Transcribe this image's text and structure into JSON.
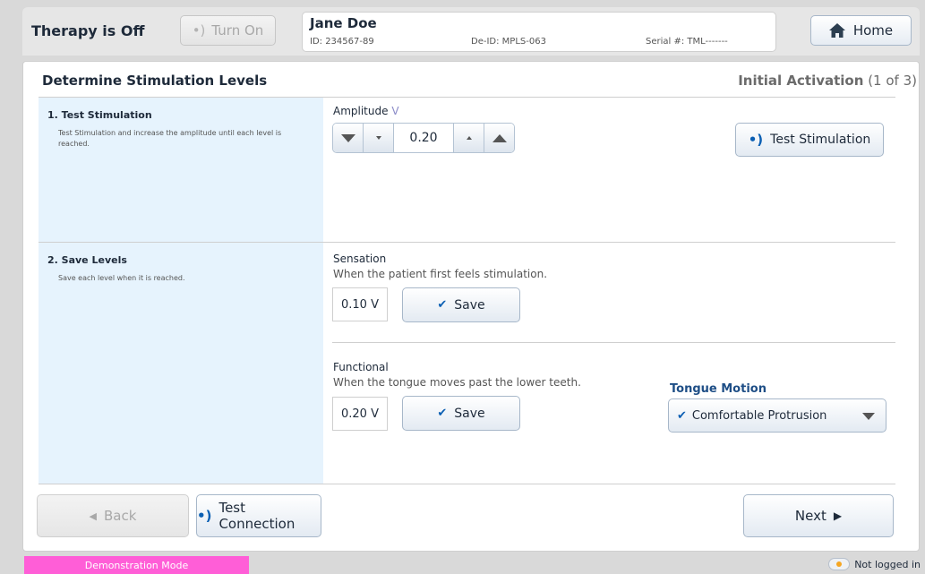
{
  "header": {
    "therapy_status": "Therapy is Off",
    "turn_on_label": "Turn On",
    "patient": {
      "name": "Jane Doe",
      "id": "ID: 234567-89",
      "deid": "De-ID: MPLS-063",
      "serial": "Serial #: TML-------"
    },
    "home_label": "Home"
  },
  "page": {
    "title": "Determine Stimulation Levels",
    "step_name": "Initial Activation",
    "step_count": "(1 of 3)"
  },
  "section1": {
    "title": "1. Test Stimulation",
    "description": "Test Stimulation and increase the amplitude until each level is reached.",
    "amplitude_label": "Amplitude",
    "amplitude_unit": "V",
    "amplitude_value": "0.20",
    "test_stim_label": "Test Stimulation"
  },
  "section2": {
    "title": "2. Save Levels",
    "description": "Save each level when it is reached.",
    "sensation": {
      "label": "Sensation",
      "description": "When the patient first feels stimulation.",
      "value": "0.10  V",
      "save_label": "Save"
    },
    "functional": {
      "label": "Functional",
      "description": "When the tongue moves past the lower teeth.",
      "value": "0.20  V",
      "save_label": "Save"
    },
    "tongue_motion": {
      "label": "Tongue Motion",
      "selected": "Comfortable Protrusion"
    }
  },
  "footer": {
    "back_label": "Back",
    "test_connection_label": "Test Connection",
    "next_label": "Next"
  },
  "status_bar": {
    "mode": "Demonstration Mode",
    "login": "Not logged in"
  },
  "colors": {
    "accent": "#0b5fb3",
    "left_panel": "#e6f3fd",
    "demo_banner": "#ff5ed7"
  },
  "icons": {
    "stimulation": "wave-icon",
    "home": "home-icon",
    "save": "check-icon",
    "back": "left-triangle-icon",
    "next": "right-triangle-icon",
    "login": "cloud-icon"
  }
}
